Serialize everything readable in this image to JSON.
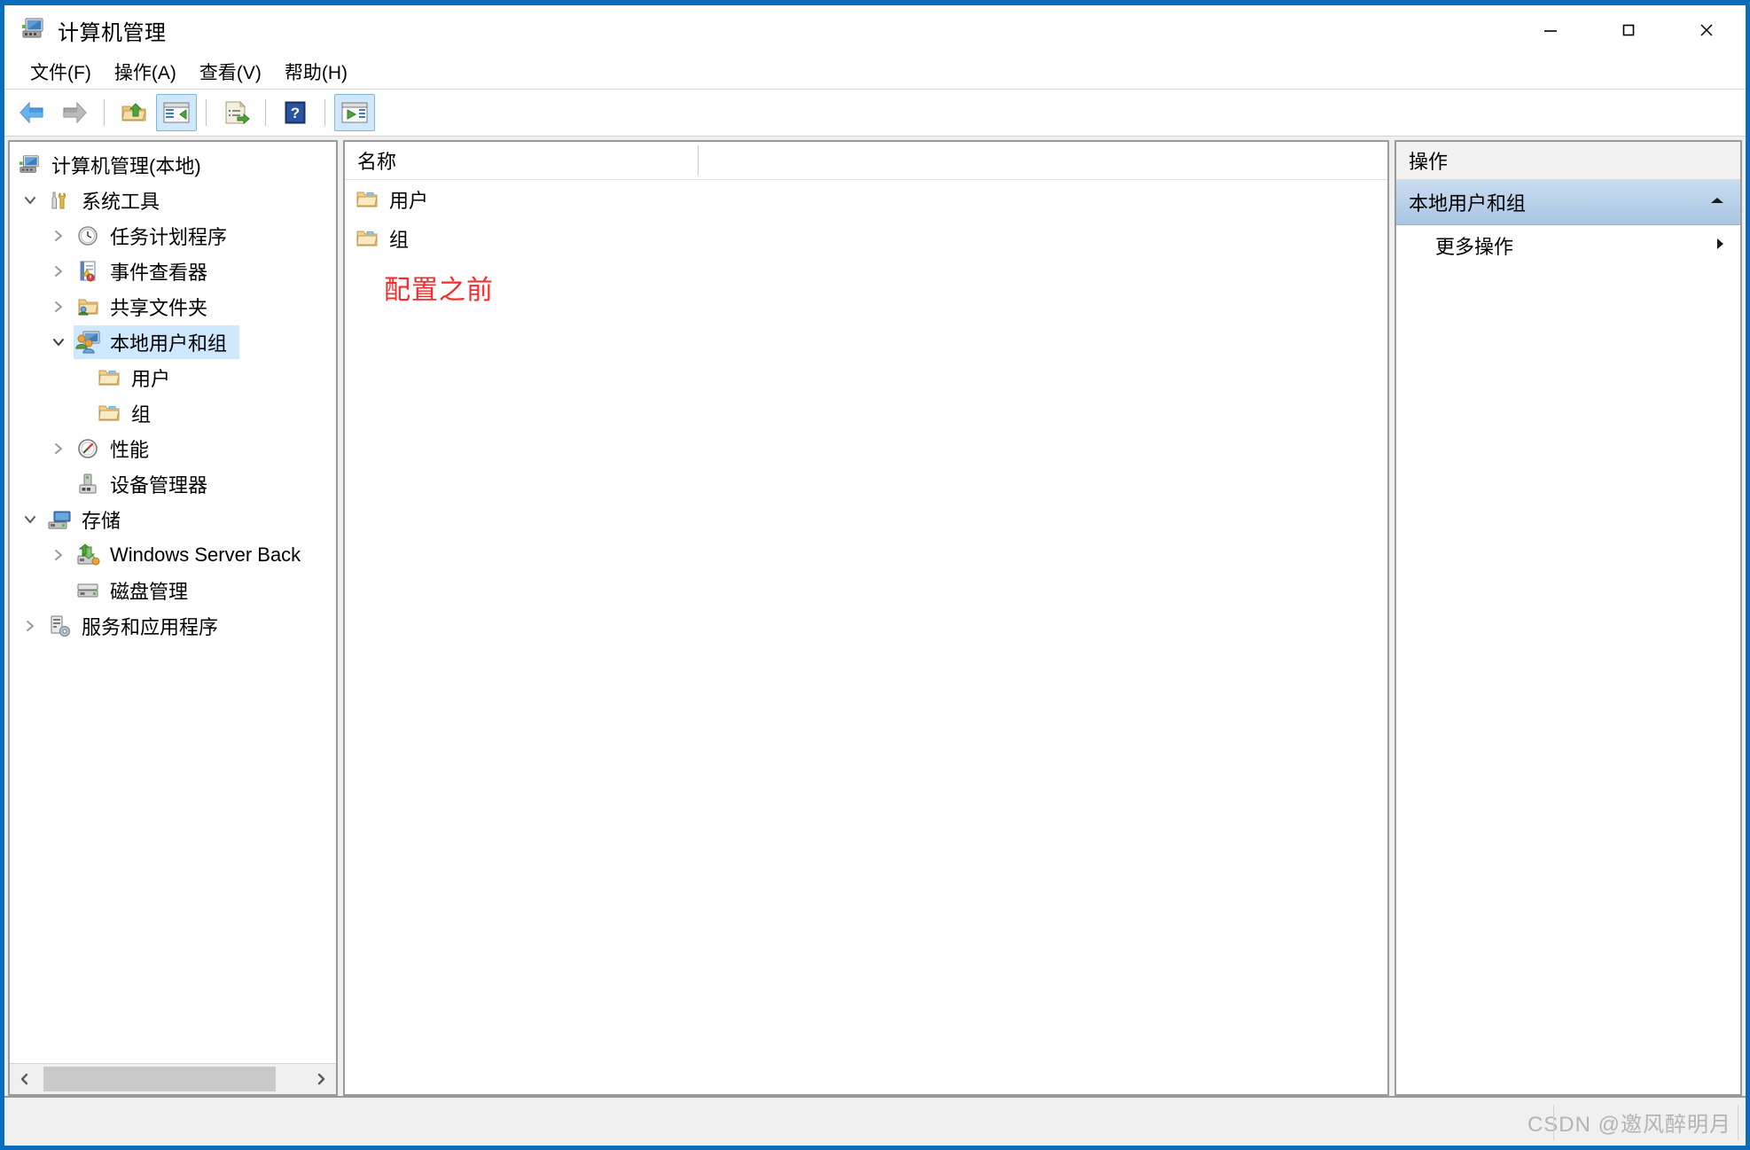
{
  "window": {
    "title": "计算机管理",
    "app_icon": "computer-management-icon",
    "accent_color": "#0a6cbc",
    "controls": {
      "minimize": "—",
      "maximize": "□",
      "close": "✕"
    }
  },
  "menubar": {
    "items": [
      {
        "label": "文件(F)",
        "name": "menu-file"
      },
      {
        "label": "操作(A)",
        "name": "menu-action"
      },
      {
        "label": "查看(V)",
        "name": "menu-view"
      },
      {
        "label": "帮助(H)",
        "name": "menu-help"
      }
    ]
  },
  "toolbar": {
    "buttons": [
      {
        "icon": "back-arrow-icon",
        "active": false
      },
      {
        "icon": "forward-arrow-icon",
        "active": false
      },
      {
        "icon": "up-folder-icon",
        "active": false
      },
      {
        "icon": "show-hide-console-tree-icon",
        "active": true
      },
      {
        "icon": "export-list-icon",
        "active": false
      },
      {
        "icon": "help-icon",
        "active": false
      },
      {
        "icon": "show-action-pane-icon",
        "active": true
      }
    ]
  },
  "tree": {
    "items": [
      {
        "label": "计算机管理(本地)",
        "icon": "computer-management-icon",
        "indent": 0,
        "twisty": "none",
        "selected": false
      },
      {
        "label": "系统工具",
        "icon": "system-tools-icon",
        "indent": 1,
        "twisty": "expanded",
        "selected": false
      },
      {
        "label": "任务计划程序",
        "icon": "task-scheduler-icon",
        "indent": 2,
        "twisty": "collapsed",
        "selected": false
      },
      {
        "label": "事件查看器",
        "icon": "event-viewer-icon",
        "indent": 2,
        "twisty": "collapsed",
        "selected": false
      },
      {
        "label": "共享文件夹",
        "icon": "shared-folders-icon",
        "indent": 2,
        "twisty": "collapsed",
        "selected": false
      },
      {
        "label": "本地用户和组",
        "icon": "local-users-groups-icon",
        "indent": 2,
        "twisty": "expanded",
        "selected": true
      },
      {
        "label": "用户",
        "icon": "folder-icon",
        "indent": 3,
        "twisty": "none",
        "selected": false
      },
      {
        "label": "组",
        "icon": "folder-icon",
        "indent": 3,
        "twisty": "none",
        "selected": false
      },
      {
        "label": "性能",
        "icon": "performance-icon",
        "indent": 2,
        "twisty": "collapsed",
        "selected": false
      },
      {
        "label": "设备管理器",
        "icon": "device-manager-icon",
        "indent": 2,
        "twisty": "none",
        "selected": false
      },
      {
        "label": "存储",
        "icon": "storage-icon",
        "indent": 1,
        "twisty": "expanded",
        "selected": false
      },
      {
        "label": "Windows Server Back",
        "icon": "windows-server-backup-icon",
        "indent": 2,
        "twisty": "collapsed",
        "selected": false
      },
      {
        "label": "磁盘管理",
        "icon": "disk-management-icon",
        "indent": 2,
        "twisty": "none",
        "selected": false
      },
      {
        "label": "服务和应用程序",
        "icon": "services-applications-icon",
        "indent": 1,
        "twisty": "collapsed",
        "selected": false
      }
    ],
    "scrollbar": {
      "left_arrow": "‹",
      "right_arrow": "›"
    }
  },
  "center": {
    "columns": [
      {
        "label": "名称"
      }
    ],
    "rows": [
      {
        "label": "用户",
        "icon": "folder-icon"
      },
      {
        "label": "组",
        "icon": "folder-icon"
      }
    ],
    "annotation": {
      "text": "配置之前",
      "color": "#fa2a2a"
    }
  },
  "actions": {
    "header": "操作",
    "group": {
      "label": "本地用户和组",
      "caret": "▲"
    },
    "items": [
      {
        "label": "更多操作",
        "caret": "▶"
      }
    ]
  },
  "statusbar": {
    "watermark": "CSDN @邀风醉明月"
  }
}
